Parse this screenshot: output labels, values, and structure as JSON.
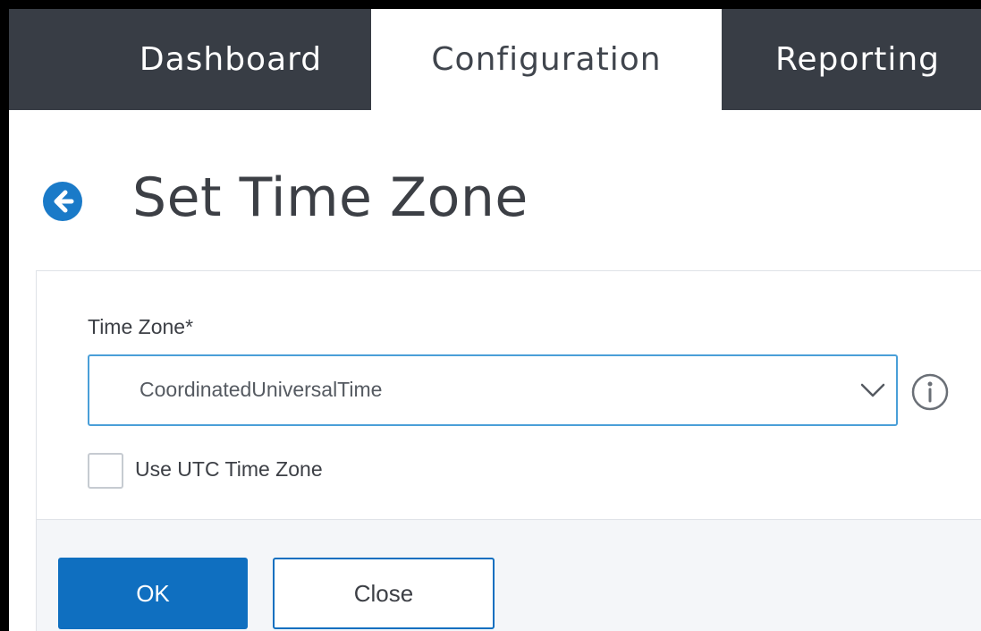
{
  "nav": {
    "tabs": [
      {
        "label": "Dashboard",
        "active": false
      },
      {
        "label": "Configuration",
        "active": true
      },
      {
        "label": "Reporting",
        "active": false
      }
    ]
  },
  "page": {
    "title": "Set Time Zone",
    "back_icon": "arrow-left-circle-icon"
  },
  "form": {
    "time_zone": {
      "label": "Time Zone*",
      "value": "CoordinatedUniversalTime",
      "dropdown_icon": "chevron-down-icon",
      "info_icon": "info-circle-icon"
    },
    "use_utc": {
      "label": "Use UTC Time Zone",
      "checked": false
    }
  },
  "actions": {
    "ok_label": "OK",
    "close_label": "Close"
  },
  "colors": {
    "nav_bg": "#383d45",
    "accent": "#0f6fc0",
    "back_icon": "#1a7ac8",
    "focus_border": "#4a9fd8"
  }
}
